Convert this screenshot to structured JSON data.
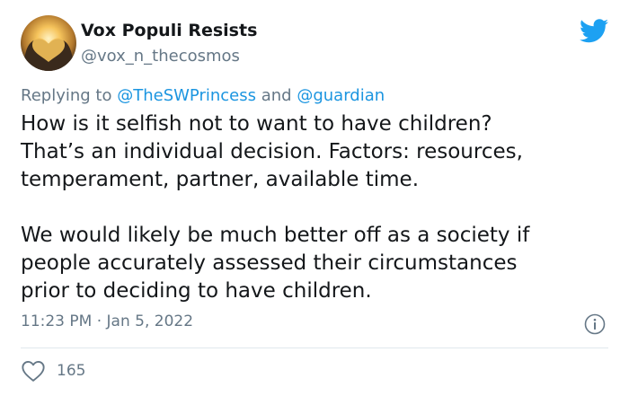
{
  "author": {
    "name": "Vox Populi Resists",
    "handle": "@vox_n_thecosmos",
    "avatar_icon": "heart-hands-sunset-avatar"
  },
  "reply": {
    "prefix": "Replying to",
    "mention_1": "@TheSWPrincess",
    "conjunction": "and",
    "mention_2": "@guardian"
  },
  "tweet": {
    "paragraph_1": "How is it selfish not to want to have children?\nThat’s an individual decision. Factors: resources,\ntemperament, partner, available time.",
    "paragraph_2": "We would likely be much better off as a society if\npeople accurately assessed their circumstances\nprior to deciding to have children."
  },
  "meta": {
    "time": "11:23 PM",
    "separator": "·",
    "date": "Jan 5, 2022"
  },
  "engagement": {
    "likes": "165"
  },
  "icons": {
    "brand": "twitter-bird-icon",
    "info": "info-icon",
    "like": "heart-outline-icon"
  },
  "colors": {
    "brand_blue": "#1da1f2",
    "mention_blue": "#1b95e0",
    "text": "#14171a",
    "secondary_text": "#657786",
    "divider": "#e1e8ed"
  }
}
